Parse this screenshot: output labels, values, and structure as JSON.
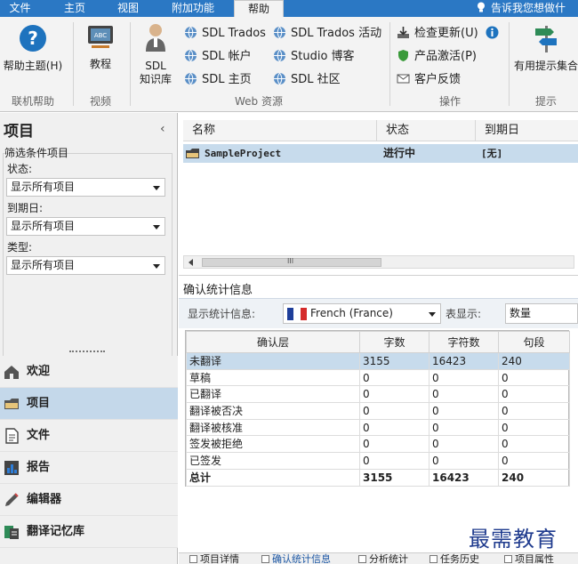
{
  "ribbon_tabs": [
    "文件",
    "主页",
    "视图",
    "附加功能",
    "帮助"
  ],
  "active_tab": "帮助",
  "tell_me": "告诉我您想做什",
  "ribbon": {
    "help_topics": "帮助主题(H)",
    "group_online_help": "联机帮助",
    "tutorial": "教程",
    "group_video": "视频",
    "sdl_knowledge_line1": "SDL",
    "sdl_knowledge_line2": "知识库",
    "web_links": [
      "SDL Trados",
      "SDL 帐户",
      "SDL 主页",
      "SDL Trados 活动",
      "Studio 博客",
      "SDL 社区"
    ],
    "group_web": "Web 资源",
    "check_updates": "检查更新(U)",
    "product_activation": "产品激活(P)",
    "customer_feedback": "客户反馈",
    "group_actions": "操作",
    "useful_tips": "有用提示集合",
    "group_tips": "提示"
  },
  "left_panel": {
    "title": "项目",
    "collapse": "‹",
    "filter_title": "筛选条件项目",
    "status_label": "状态:",
    "status_value": "显示所有项目",
    "due_label": "到期日:",
    "due_value": "显示所有项目",
    "type_label": "类型:",
    "type_value": "显示所有项目"
  },
  "nav": [
    {
      "label": "欢迎",
      "icon": "home-icon"
    },
    {
      "label": "项目",
      "icon": "folder-icon"
    },
    {
      "label": "文件",
      "icon": "file-icon"
    },
    {
      "label": "报告",
      "icon": "report-icon"
    },
    {
      "label": "编辑器",
      "icon": "pencil-icon"
    },
    {
      "label": "翻译记忆库",
      "icon": "tm-icon"
    }
  ],
  "active_nav": "项目",
  "project_table": {
    "headers": [
      "名称",
      "状态",
      "到期日"
    ],
    "rows": [
      {
        "name": "SampleProject",
        "status": "进行中",
        "due": "[无]"
      }
    ]
  },
  "scrollbar_grip": "III",
  "stats": {
    "title": "确认统计信息",
    "show_stats_label": "显示统计信息:",
    "language": "French (France)",
    "table_show_label": "表显示:",
    "table_show_value": "数量",
    "headers": [
      "确认层",
      "字数",
      "字符数",
      "句段"
    ],
    "rows": [
      [
        "未翻译",
        "3155",
        "16423",
        "240"
      ],
      [
        "草稿",
        "0",
        "0",
        "0"
      ],
      [
        "已翻译",
        "0",
        "0",
        "0"
      ],
      [
        "翻译被否决",
        "0",
        "0",
        "0"
      ],
      [
        "翻译被核准",
        "0",
        "0",
        "0"
      ],
      [
        "签发被拒绝",
        "0",
        "0",
        "0"
      ],
      [
        "已签发",
        "0",
        "0",
        "0"
      ],
      [
        "总计",
        "3155",
        "16423",
        "240"
      ]
    ]
  },
  "bottom_tabs": [
    "项目详情",
    "确认统计信息",
    "分析统计",
    "任务历史",
    "项目属性"
  ],
  "watermark": "最需教育",
  "colors": {
    "ribbon_tab_bar": "#2b78c4",
    "selection": "#c7dbec",
    "help_blue": "#1e73be"
  }
}
